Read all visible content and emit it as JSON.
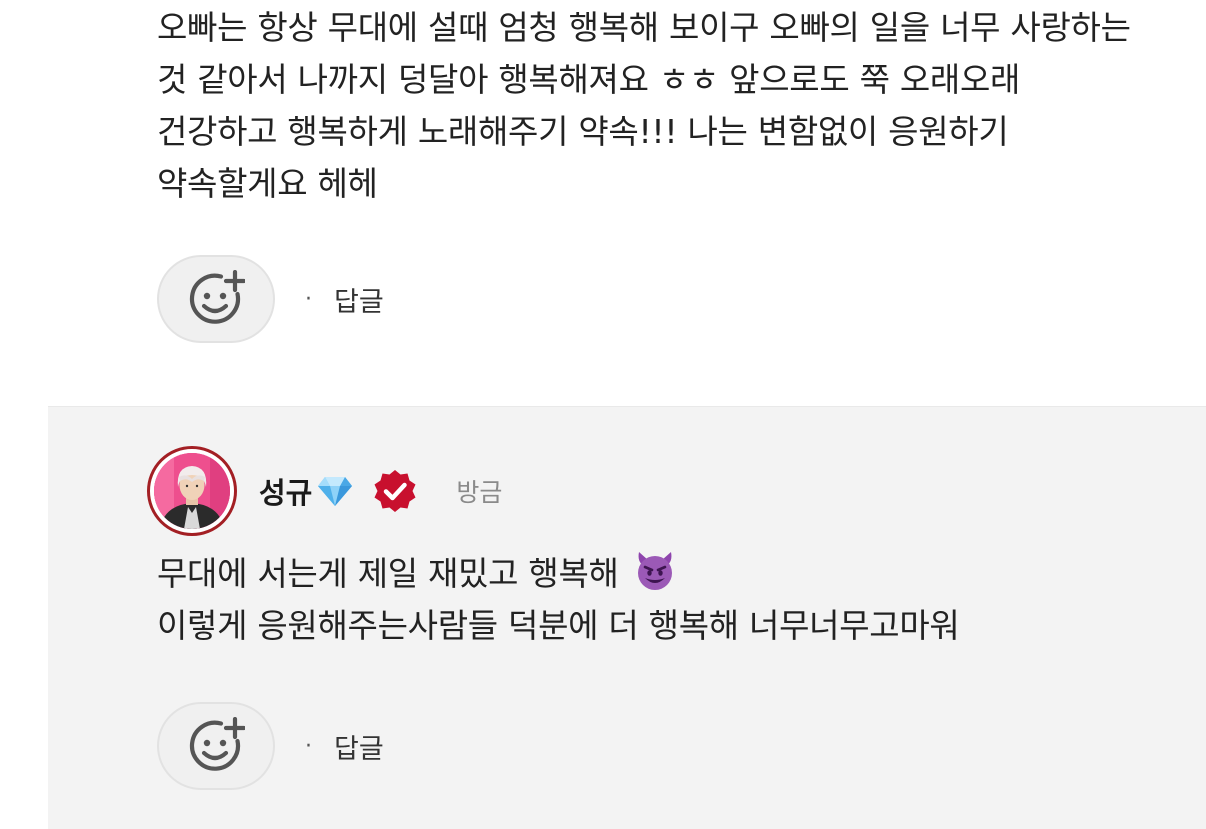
{
  "first_comment": {
    "text": "오빠는 항상 무대에 설때 엄청 행복해 보이구 오빠의 일을 너무 사랑하는 것 같아서 나까지 덩달아 행복해져요 ㅎㅎ 앞으로도 쭉 오래오래 건강하고 행복하게 노래해주기 약속!!! 나는 변함없이 응원하기 약속할게요 헤헤",
    "reply_label": "답글",
    "separator": "·"
  },
  "reply": {
    "author_name": "성규",
    "timestamp": "방금",
    "line1": "무대에 서는게 제일 재밌고 행복해",
    "line1_emoji": "smiling-devil-icon",
    "line2": "이렇게 응원해주는사람들 덕분에 더 행복해 너무너무고마워",
    "reply_label": "답글",
    "separator": "·"
  },
  "icons": {
    "reaction": "add-reaction-smile-icon",
    "diamond": "diamond-icon",
    "verified": "verified-badge-icon"
  },
  "colors": {
    "reply_background": "#f3f3f3",
    "avatar_ring": "#a31f24",
    "verified_badge": "#c8102e",
    "diamond": "#5ab4f0",
    "devil_emoji": "#8e44ad"
  }
}
